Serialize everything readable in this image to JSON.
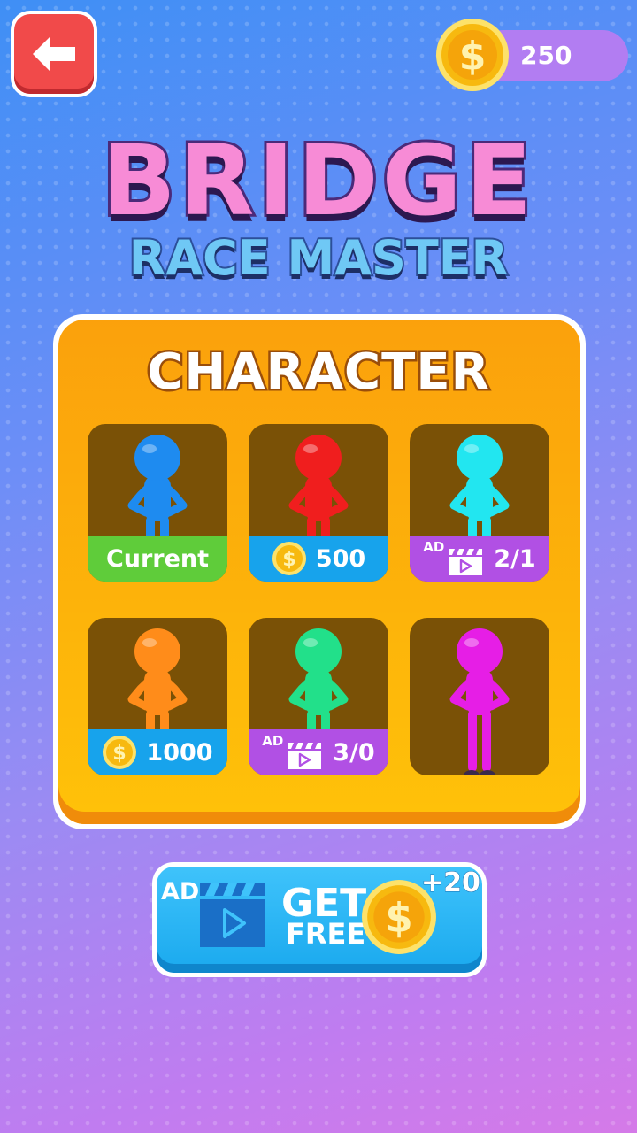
{
  "top_bar": {
    "back_icon": "arrow-left-icon",
    "coins": "250"
  },
  "logo": {
    "title": "BRIDGE",
    "subtitle": "RACE MASTER"
  },
  "panel": {
    "title": "CHARACTER",
    "characters": [
      {
        "color": "#1e8bf0",
        "footer": "Current",
        "footer_type": "current"
      },
      {
        "color": "#f01e1e",
        "footer": "500",
        "footer_type": "price"
      },
      {
        "color": "#22e6f0",
        "footer": "2/1",
        "footer_type": "ad"
      },
      {
        "color": "#ff8c1a",
        "footer": "1000",
        "footer_type": "price"
      },
      {
        "color": "#22e08a",
        "footer": "3/0",
        "footer_type": "ad"
      },
      {
        "color": "#e61ee6",
        "footer": "",
        "footer_type": "none"
      }
    ],
    "ad_label": "AD"
  },
  "get_free": {
    "ad_label": "AD",
    "get": "GET",
    "free": "FREE",
    "bonus": "+20"
  },
  "colors": {
    "accent_orange": "#fdb40a",
    "button_blue": "#1aa9ee",
    "back_red": "#f14a4a",
    "coin_gold": "#f7b90f"
  }
}
